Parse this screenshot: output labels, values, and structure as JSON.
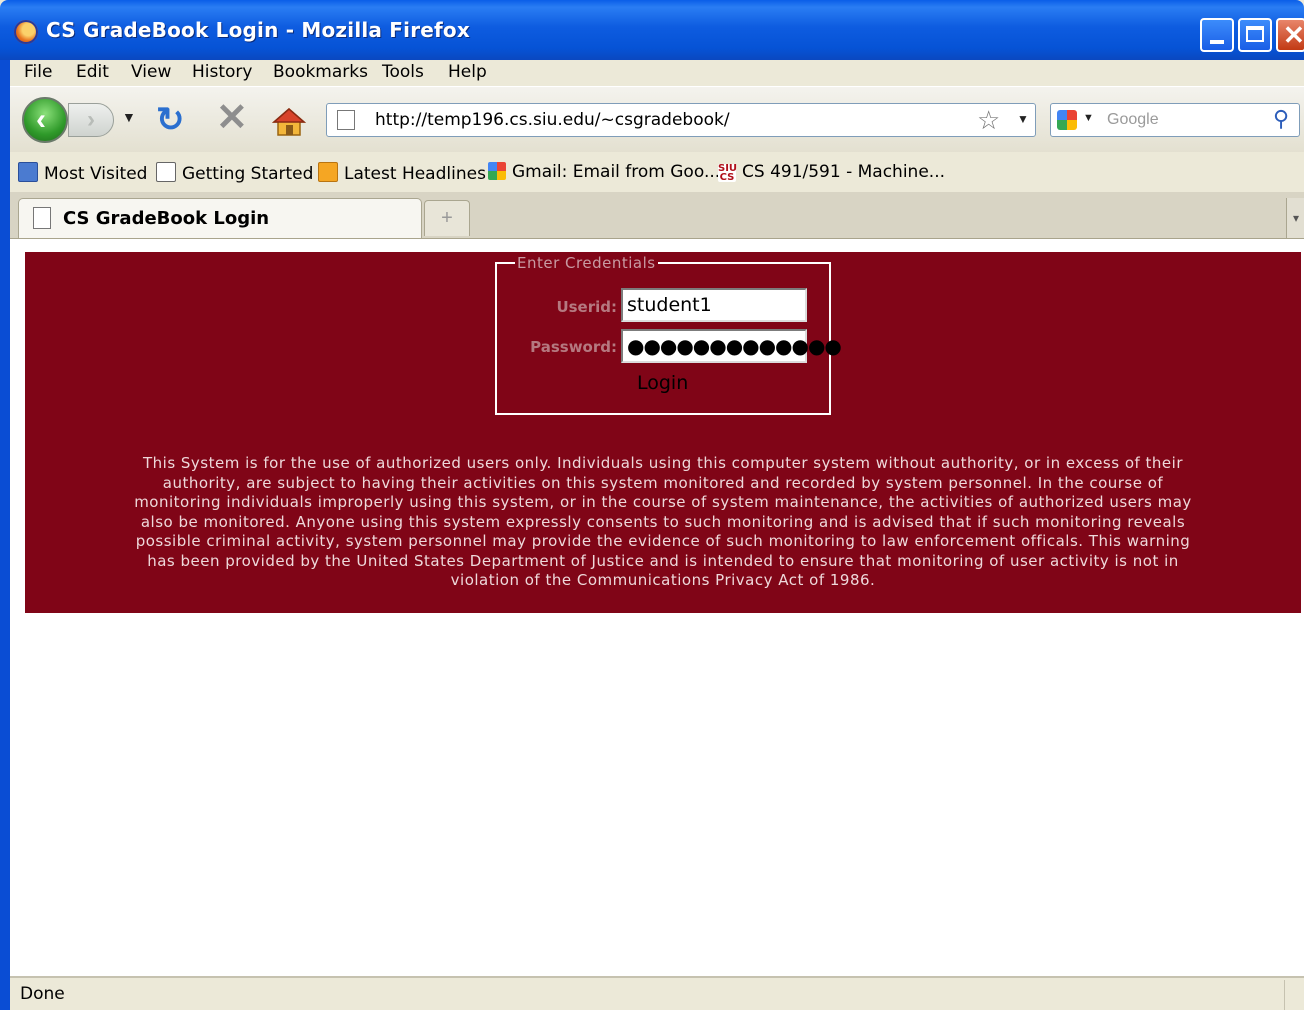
{
  "window": {
    "title": "CS GradeBook Login - Mozilla Firefox"
  },
  "menu": [
    "File",
    "Edit",
    "View",
    "History",
    "Bookmarks",
    "Tools",
    "Help"
  ],
  "nav": {
    "url": "http://temp196.cs.siu.edu/~csgradebook/",
    "search_placeholder": "Google"
  },
  "bookmarks": [
    {
      "label": "Most Visited",
      "icon": "most-visited-icon"
    },
    {
      "label": "Getting Started",
      "icon": "page-icon"
    },
    {
      "label": "Latest Headlines",
      "icon": "rss-icon"
    },
    {
      "label": "Gmail: Email from Goo...",
      "icon": "google-icon"
    },
    {
      "label": "CS 491/591 - Machine...",
      "icon": "siuc-cs-icon"
    }
  ],
  "tabs": [
    {
      "label": "CS GradeBook Login",
      "active": true
    }
  ],
  "form": {
    "legend": "Enter Credentials",
    "userid_label": "Userid:",
    "userid_value": "student1",
    "password_label": "Password:",
    "password_value": "●●●●●●●●●●●●●",
    "login_label": "Login"
  },
  "warning_text": "This System is for the use of authorized users only. Individuals using this computer system without authority, or in excess of their authority, are subject to having their activities on this system monitored and recorded by system personnel. In the course of monitoring individuals improperly using this system, or in the course of system maintenance, the activities of authorized users may also be monitored. Anyone using this system expressly consents to such monitoring and is advised that if such monitoring reveals possible criminal activity, system personnel may provide the evidence of such monitoring to law enforcement officals. This warning has been provided by the United States Department of Justice and is intended to ensure that monitoring of user activity is not in violation of the Communications Privacy Act of 1986.",
  "status": "Done",
  "colors": {
    "banner": "#800517",
    "titlebar": "#0653d6"
  }
}
